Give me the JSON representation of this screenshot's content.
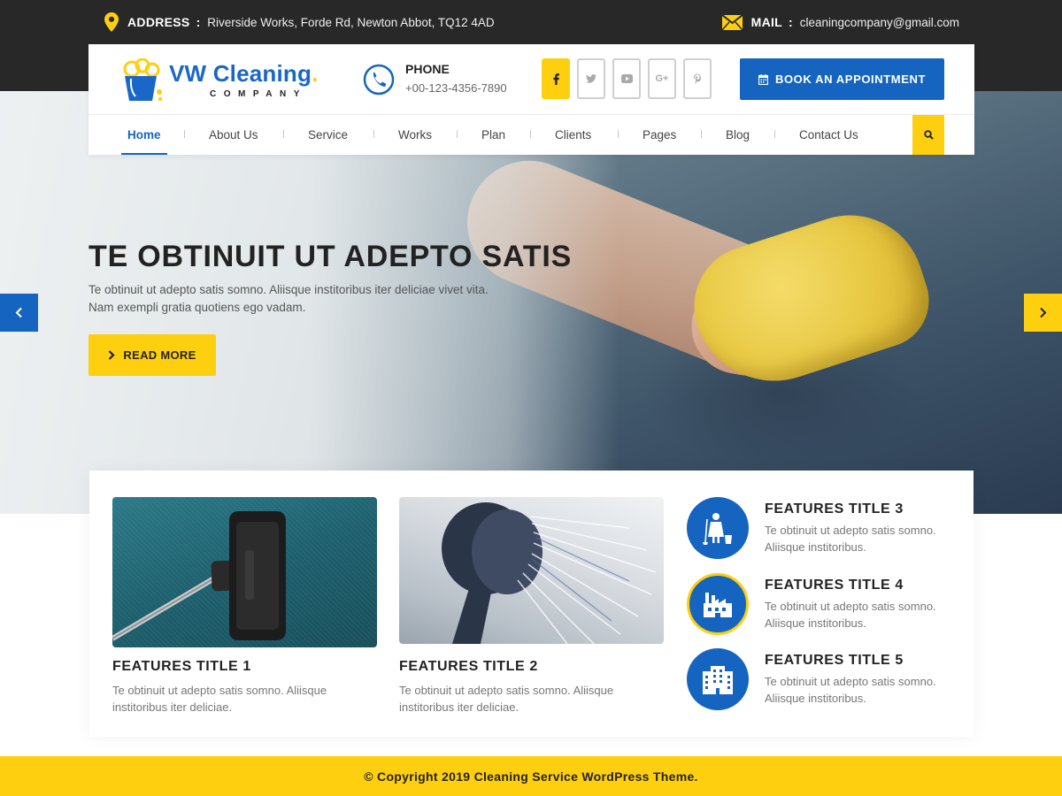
{
  "topbar": {
    "address_label": "ADDRESS",
    "address_value": "Riverside Works, Forde Rd, Newton Abbot, TQ12 4AD",
    "mail_label": "MAIL",
    "mail_value": "cleaningcompany@gmail.com",
    "separator": ":"
  },
  "header": {
    "logo_title": "VW Cleaning",
    "logo_dot": ".",
    "logo_subtitle": "COMPANY",
    "phone_label": "PHONE",
    "phone_value": "+00-123-4356-7890",
    "social": [
      "f",
      "t",
      "yt",
      "G+",
      "p"
    ],
    "book_label": "BOOK AN APPOINTMENT"
  },
  "nav": {
    "items": [
      "Home",
      "About Us",
      "Service",
      "Works",
      "Plan",
      "Clients",
      "Pages",
      "Blog",
      "Contact Us"
    ],
    "active": "Home"
  },
  "hero": {
    "title": "TE OBTINUIT UT ADEPTO SATIS",
    "text_line1": "Te obtinuit ut adepto satis somno. Aliisque institoribus iter deliciae vivet vita.",
    "text_line2": "Nam exempli gratia quotiens ego vadam.",
    "button_label": "READ MORE",
    "prev_icon": "chevron-left",
    "next_icon": "chevron-right"
  },
  "features": {
    "f1": {
      "title": "FEATURES TITLE 1",
      "desc": "Te obtinuit ut adepto satis somno. Aliisque institoribus iter deliciae."
    },
    "f2": {
      "title": "FEATURES TITLE 2",
      "desc": "Te obtinuit ut adepto satis somno. Aliisque institoribus iter deliciae."
    },
    "f3": {
      "title": "FEATURES TITLE 3",
      "desc": "Te obtinuit ut adepto satis somno. Aliisque institoribus.",
      "icon": "maid-icon"
    },
    "f4": {
      "title": "FEATURES TITLE 4",
      "desc": "Te obtinuit ut adepto satis somno. Aliisque institoribus.",
      "icon": "factory-icon"
    },
    "f5": {
      "title": "FEATURES TITLE 5",
      "desc": "Te obtinuit ut adepto satis somno. Aliisque institoribus.",
      "icon": "building-icon"
    }
  },
  "footer": {
    "copyright": "© Copyright 2019 Cleaning Service WordPress Theme."
  },
  "colors": {
    "primary_blue": "#1565c0",
    "accent_yellow": "#fecf0f",
    "topbar_dark": "#282828"
  }
}
